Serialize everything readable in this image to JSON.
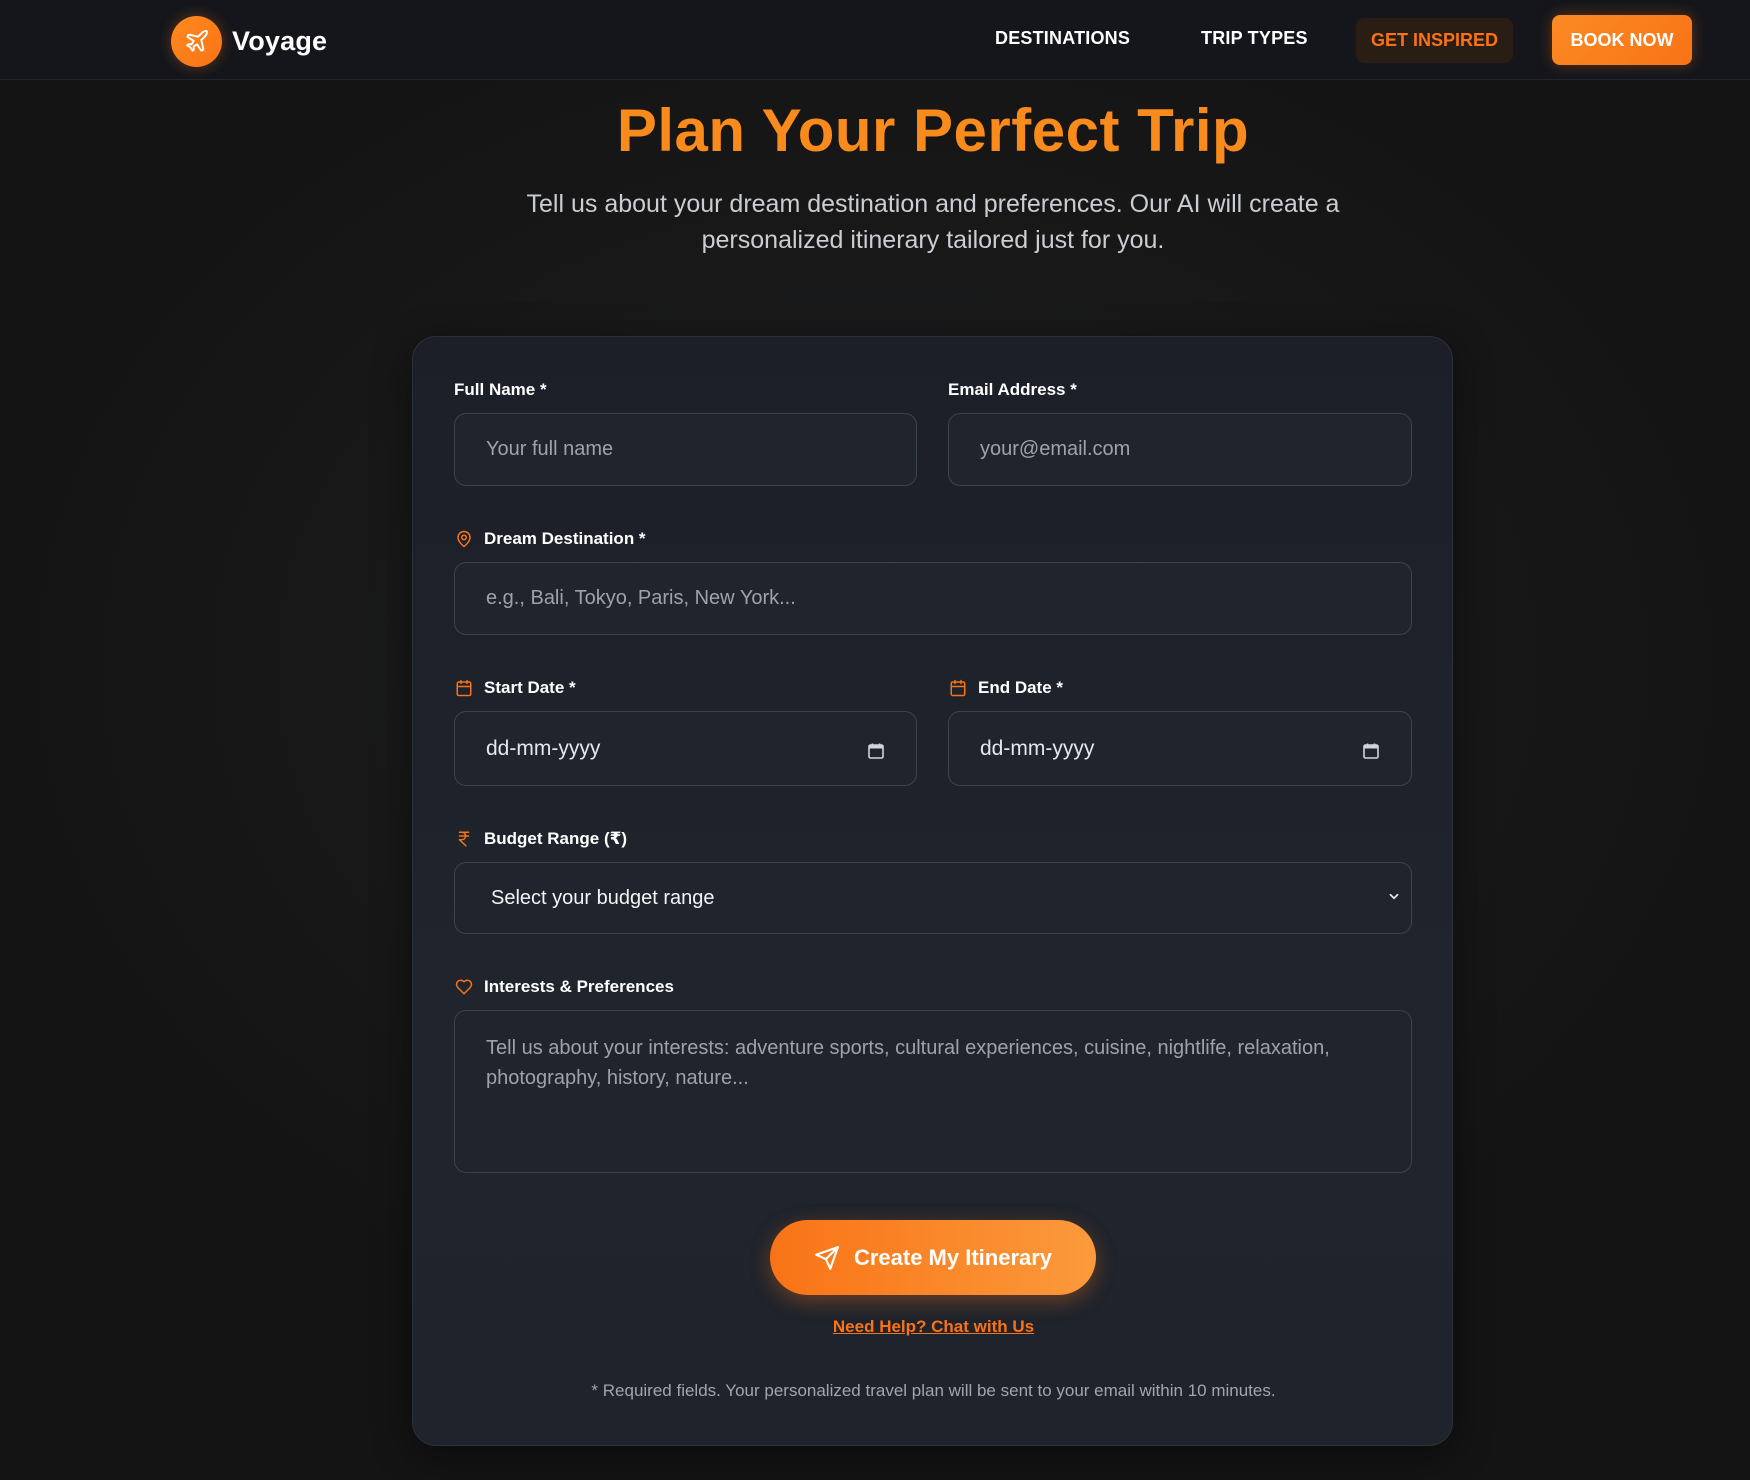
{
  "header": {
    "brand": "Voyage",
    "brand_icon": "plane-icon",
    "nav": {
      "destinations": "DESTINATIONS",
      "trip_types": "TRIP TYPES",
      "get_inspired": "GET INSPIRED",
      "book_now": "BOOK NOW"
    }
  },
  "hero": {
    "title": "Plan Your Perfect Trip",
    "subtitle": "Tell us about your dream destination and preferences. Our AI will create a personalized itinerary tailored just for you."
  },
  "form": {
    "full_name": {
      "label": "Full Name *",
      "placeholder": "Your full name"
    },
    "email": {
      "label": "Email Address *",
      "placeholder": "your@email.com"
    },
    "destination": {
      "label": "Dream Destination *",
      "placeholder": "e.g., Bali, Tokyo, Paris, New York...",
      "icon": "map-pin-icon"
    },
    "start_date": {
      "label": "Start Date *",
      "value": "dd-mm-yyyy",
      "icon": "calendar-icon"
    },
    "end_date": {
      "label": "End Date *",
      "value": "dd-mm-yyyy",
      "icon": "calendar-icon"
    },
    "budget": {
      "label": "Budget Range (₹)",
      "selected": "Select your budget range",
      "icon": "rupee-icon"
    },
    "interests": {
      "label": "Interests & Preferences",
      "placeholder": "Tell us about your interests: adventure sports, cultural experiences, cuisine, nightlife, relaxation, photography, history, nature...",
      "icon": "heart-icon"
    },
    "submit": "Create My Itinerary",
    "help_link": "Need Help? Chat with Us",
    "footnote": "* Required fields. Your personalized travel plan will be sent to your email within 10 minutes."
  },
  "colors": {
    "accent": "#f97316",
    "background": "#171717",
    "card": "#1f232b",
    "text": "#ffffff"
  }
}
